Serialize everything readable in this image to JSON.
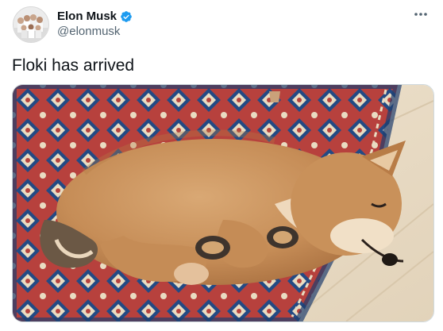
{
  "author": {
    "display_name": "Elon Musk",
    "handle": "@elonmusk",
    "verified": true,
    "verified_color": "#1d9bf0"
  },
  "menu": {
    "icon": "more-horizontal-icon",
    "label": "•••"
  },
  "tweet": {
    "text": "Floki has arrived"
  },
  "colors": {
    "text_primary": "#0f1419",
    "text_secondary": "#536471",
    "border": "#cfd9de"
  }
}
